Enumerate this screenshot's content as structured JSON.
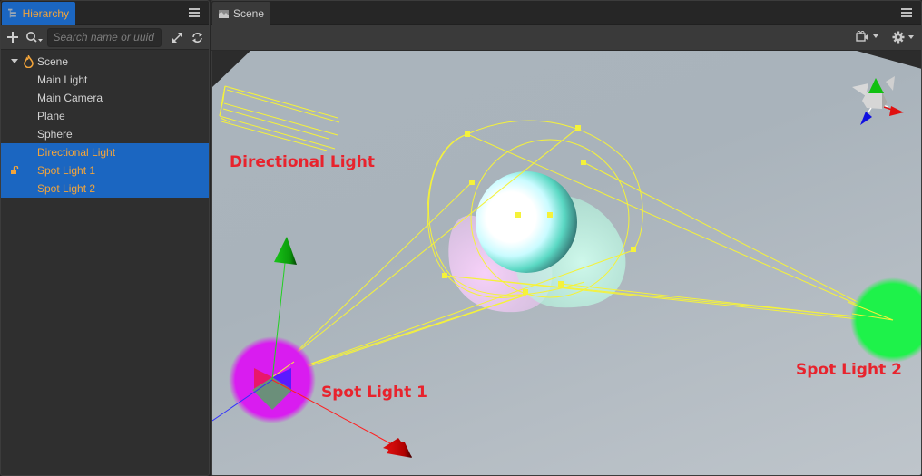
{
  "hierarchy": {
    "tab_label": "Hierarchy",
    "search_placeholder": "Search name or uuid",
    "search_value": "",
    "tools": {
      "add": "add-icon",
      "search_filter": "search-filter-icon",
      "expand": "expand-icon",
      "refresh": "refresh-icon"
    },
    "root": {
      "label": "Scene",
      "icon": "scene-fire-icon",
      "expanded": true
    },
    "nodes": [
      {
        "label": "Main Light",
        "selected": false,
        "locked": false
      },
      {
        "label": "Main Camera",
        "selected": false,
        "locked": false
      },
      {
        "label": "Plane",
        "selected": false,
        "locked": false
      },
      {
        "label": "Sphere",
        "selected": false,
        "locked": false
      },
      {
        "label": "Directional Light",
        "selected": true,
        "locked": false
      },
      {
        "label": "Spot Light 1",
        "selected": true,
        "locked": true
      },
      {
        "label": "Spot Light 2",
        "selected": true,
        "locked": false
      }
    ]
  },
  "scene": {
    "tab_label": "Scene",
    "tab_icon": "scene-image-icon",
    "toolbar": {
      "camera": "camera-icon",
      "settings": "gear-icon"
    },
    "annotations": {
      "directional_light": "Directional Light",
      "spot_light_1": "Spot Light 1",
      "spot_light_2": "Spot Light 2"
    }
  },
  "colors": {
    "selection_bg": "#1b66c1",
    "selection_text": "#f3a43a",
    "annotation_text": "#e8232d",
    "gizmo_yellow": "#f5f23a",
    "spot_light_1": "#d91cf0",
    "spot_light_2": "#1ef24a",
    "axis_x": "#e01010",
    "axis_y": "#10c010",
    "axis_z": "#1010e0"
  }
}
